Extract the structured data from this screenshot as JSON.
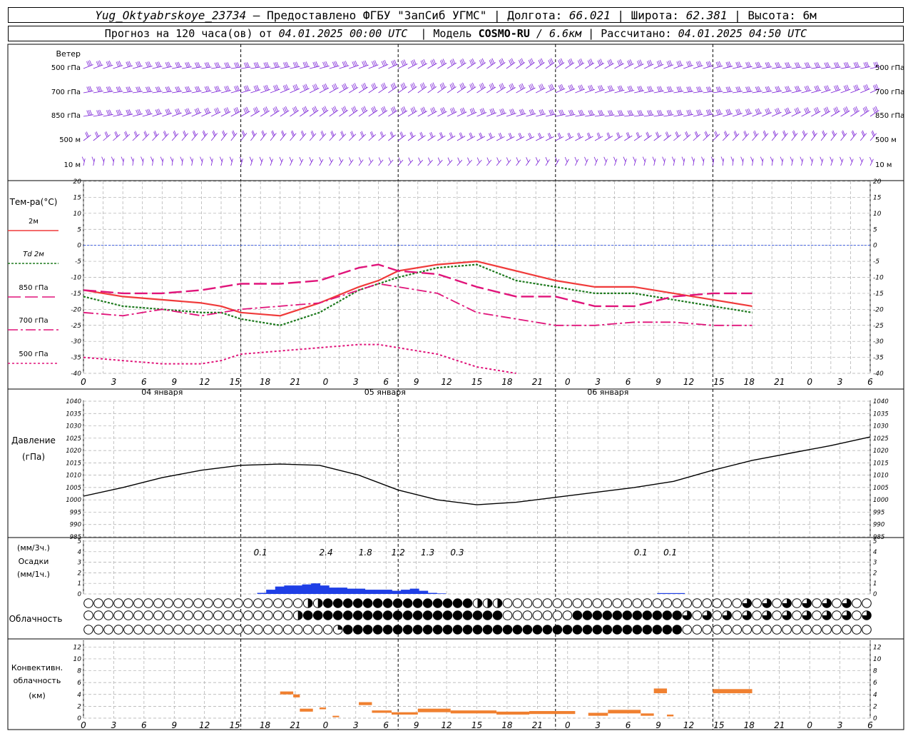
{
  "header": {
    "station": "Yug_Oktyabrskoye_23734",
    "provided": " – Предоставлено ФГБУ \"ЗапСиб УГМС\" | Долгота:",
    "lon": "66.021",
    "lat_label": "| Широта:",
    "lat": "62.381",
    "alt_label": "| Высота: 6м",
    "forecast_prefix": "Прогноз на 120 часа(ов) от",
    "forecast_time": "04.01.2025 00:00 UTC",
    "model_label": "| Модель",
    "model": "COSMO-RU",
    "res": "/ 6.6км",
    "calc_label": "| Рассчитано:",
    "calc_time": "04.01.2025 04:50 UTC"
  },
  "panels": {
    "wind": {
      "title": "Ветер",
      "levels": [
        "500 гПа",
        "700 гПа",
        "850 гПа",
        "500 м",
        "10   м"
      ],
      "color": "#7a1fd6"
    },
    "temp": {
      "title": "Тем-ра(°С)",
      "legend": [
        {
          "label": "2м",
          "color": "#f03a3a",
          "dash": "none"
        },
        {
          "label": "Td  2м",
          "color": "#1e7a1e",
          "dash": "3,2"
        },
        {
          "label": "850 гПа",
          "color": "#e0147a",
          "dash": "18,6"
        },
        {
          "label": "700 гПа",
          "color": "#e0147a",
          "dash": "14,4,3,4"
        },
        {
          "label": "500 гПа",
          "color": "#e0147a",
          "dash": "3,3"
        }
      ]
    },
    "pressure": {
      "title": "Давление",
      "unit": "(гПа)"
    },
    "precip": {
      "unit1": "(мм/3ч.)",
      "title": "Осадки",
      "unit2": "(мм/1ч.)",
      "totals": [
        "0.1",
        "2.4",
        "1.8",
        "1.2",
        "1.3",
        "0.3",
        "0.1",
        "0.1"
      ]
    },
    "cloud": {
      "title": "Облачность"
    },
    "conv": {
      "title1": "Конвективн.",
      "title2": "облачность",
      "unit": "(км)"
    }
  },
  "days": [
    "04 января",
    "05 января",
    "06 января"
  ],
  "hour_ticks": [
    "0",
    "3",
    "6",
    "9",
    "12",
    "15",
    "18",
    "21",
    "0",
    "3",
    "6",
    "9",
    "12",
    "15",
    "18",
    "21",
    "0",
    "3",
    "6",
    "9",
    "12",
    "15",
    "18",
    "21",
    "0",
    "3",
    "6"
  ],
  "chart_data": [
    {
      "type": "line",
      "title": "Тем-ра(°С)",
      "x_hours": [
        0,
        6,
        12,
        18,
        21,
        24,
        30,
        36,
        42,
        45,
        48,
        54,
        60,
        66,
        72,
        78,
        84,
        90,
        96,
        102
      ],
      "ylim": [
        -40,
        20
      ],
      "series": [
        {
          "name": "2м",
          "values": [
            -14,
            -16,
            -17,
            -18,
            -19,
            -21,
            -22,
            -18,
            -13,
            -11,
            -8,
            -6,
            -5,
            -8,
            -11,
            -13,
            -13,
            -15,
            -17,
            -19
          ]
        },
        {
          "name": "Td  2м",
          "values": [
            -16,
            -19,
            -20,
            -21,
            -21,
            -23,
            -25,
            -21,
            -14,
            -12,
            -10,
            -7,
            -6,
            -11,
            -13,
            -15,
            -15,
            -17,
            -19,
            -21
          ]
        },
        {
          "name": "850 гПа",
          "values": [
            -14,
            -15,
            -15,
            -14,
            -13,
            -12,
            -12,
            -11,
            -7,
            -6,
            -8,
            -9,
            -13,
            -16,
            -16,
            -19,
            -19,
            -16,
            -15,
            -15
          ]
        },
        {
          "name": "700 гПа",
          "values": [
            -21,
            -22,
            -20,
            -22,
            -21,
            -20,
            -19,
            -18,
            -14,
            -12,
            -13,
            -15,
            -21,
            -23,
            -25,
            -25,
            -24,
            -24,
            -25,
            -25
          ]
        },
        {
          "name": "500 гПа",
          "values": [
            -35,
            -36,
            -37,
            -37,
            -36,
            -34,
            -33,
            -32,
            -31,
            -31,
            -32,
            -34,
            -38,
            -41,
            null,
            null,
            null,
            null,
            null,
            null
          ]
        }
      ]
    },
    {
      "type": "line",
      "title": "Давление",
      "x_hours": [
        0,
        6,
        12,
        18,
        24,
        30,
        36,
        42,
        48,
        54,
        60,
        66,
        72,
        78,
        84,
        90,
        96,
        102,
        108,
        114,
        120
      ],
      "ylim": [
        985,
        1040
      ],
      "series": [
        {
          "name": "",
          "values": [
            1001.5,
            1005,
            1009,
            1012,
            1014,
            1014.5,
            1014,
            1010,
            1004,
            1000,
            998,
            999,
            1001,
            1003,
            1005,
            1007.5,
            1012,
            1016,
            1019,
            1022,
            1025.5
          ]
        }
      ]
    },
    {
      "type": "bar",
      "title": "Осадки",
      "x_hours": [
        30,
        31,
        32,
        33,
        34,
        35,
        36,
        37,
        38,
        39,
        40,
        41,
        42,
        43,
        44,
        45,
        46,
        47,
        48,
        49,
        50
      ],
      "ylim": [
        0,
        5
      ],
      "series": [
        {
          "name": "",
          "values": [
            0.1,
            0.4,
            0.7,
            0.8,
            0.8,
            0.9,
            1.0,
            0.8,
            0.6,
            0.6,
            0.5,
            0.5,
            0.4,
            0.4,
            0.4,
            0.3,
            0.4,
            0.5,
            0.3,
            0.1,
            0.05
          ]
        }
      ],
      "totals": [
        "0.1",
        "2.4",
        "1.8",
        "1.2",
        "1.3",
        "0.3",
        "0.1",
        "0.1"
      ]
    },
    {
      "type": "bar",
      "title": "Конвективн. облачность",
      "ylim": [
        0,
        12
      ],
      "segments": [
        {
          "x0": 30,
          "x1": 32,
          "y0": 4,
          "y1": 4.5
        },
        {
          "x0": 32,
          "x1": 33,
          "y0": 3.5,
          "y1": 4
        },
        {
          "x0": 33,
          "x1": 35,
          "y0": 1.1,
          "y1": 1.6
        },
        {
          "x0": 36,
          "x1": 37,
          "y0": 1.5,
          "y1": 1.8
        },
        {
          "x0": 38,
          "x1": 39,
          "y0": 0.2,
          "y1": 0.4
        },
        {
          "x0": 42,
          "x1": 44,
          "y0": 2.2,
          "y1": 2.7
        },
        {
          "x0": 44,
          "x1": 47,
          "y0": 0.9,
          "y1": 1.3
        },
        {
          "x0": 47,
          "x1": 51,
          "y0": 0.6,
          "y1": 1.0
        },
        {
          "x0": 51,
          "x1": 56,
          "y0": 1.0,
          "y1": 1.6
        },
        {
          "x0": 56,
          "x1": 63,
          "y0": 0.8,
          "y1": 1.3
        },
        {
          "x0": 63,
          "x1": 68,
          "y0": 0.6,
          "y1": 1.1
        },
        {
          "x0": 68,
          "x1": 75,
          "y0": 0.7,
          "y1": 1.2
        },
        {
          "x0": 77,
          "x1": 80,
          "y0": 0.4,
          "y1": 0.9
        },
        {
          "x0": 80,
          "x1": 85,
          "y0": 0.8,
          "y1": 1.4
        },
        {
          "x0": 85,
          "x1": 87,
          "y0": 0.4,
          "y1": 0.8
        },
        {
          "x0": 87,
          "x1": 89,
          "y0": 4.2,
          "y1": 5
        },
        {
          "x0": 89,
          "x1": 90,
          "y0": 0.3,
          "y1": 0.6
        },
        {
          "x0": 96,
          "x1": 102,
          "y0": 4.2,
          "y1": 4.9
        }
      ]
    }
  ]
}
